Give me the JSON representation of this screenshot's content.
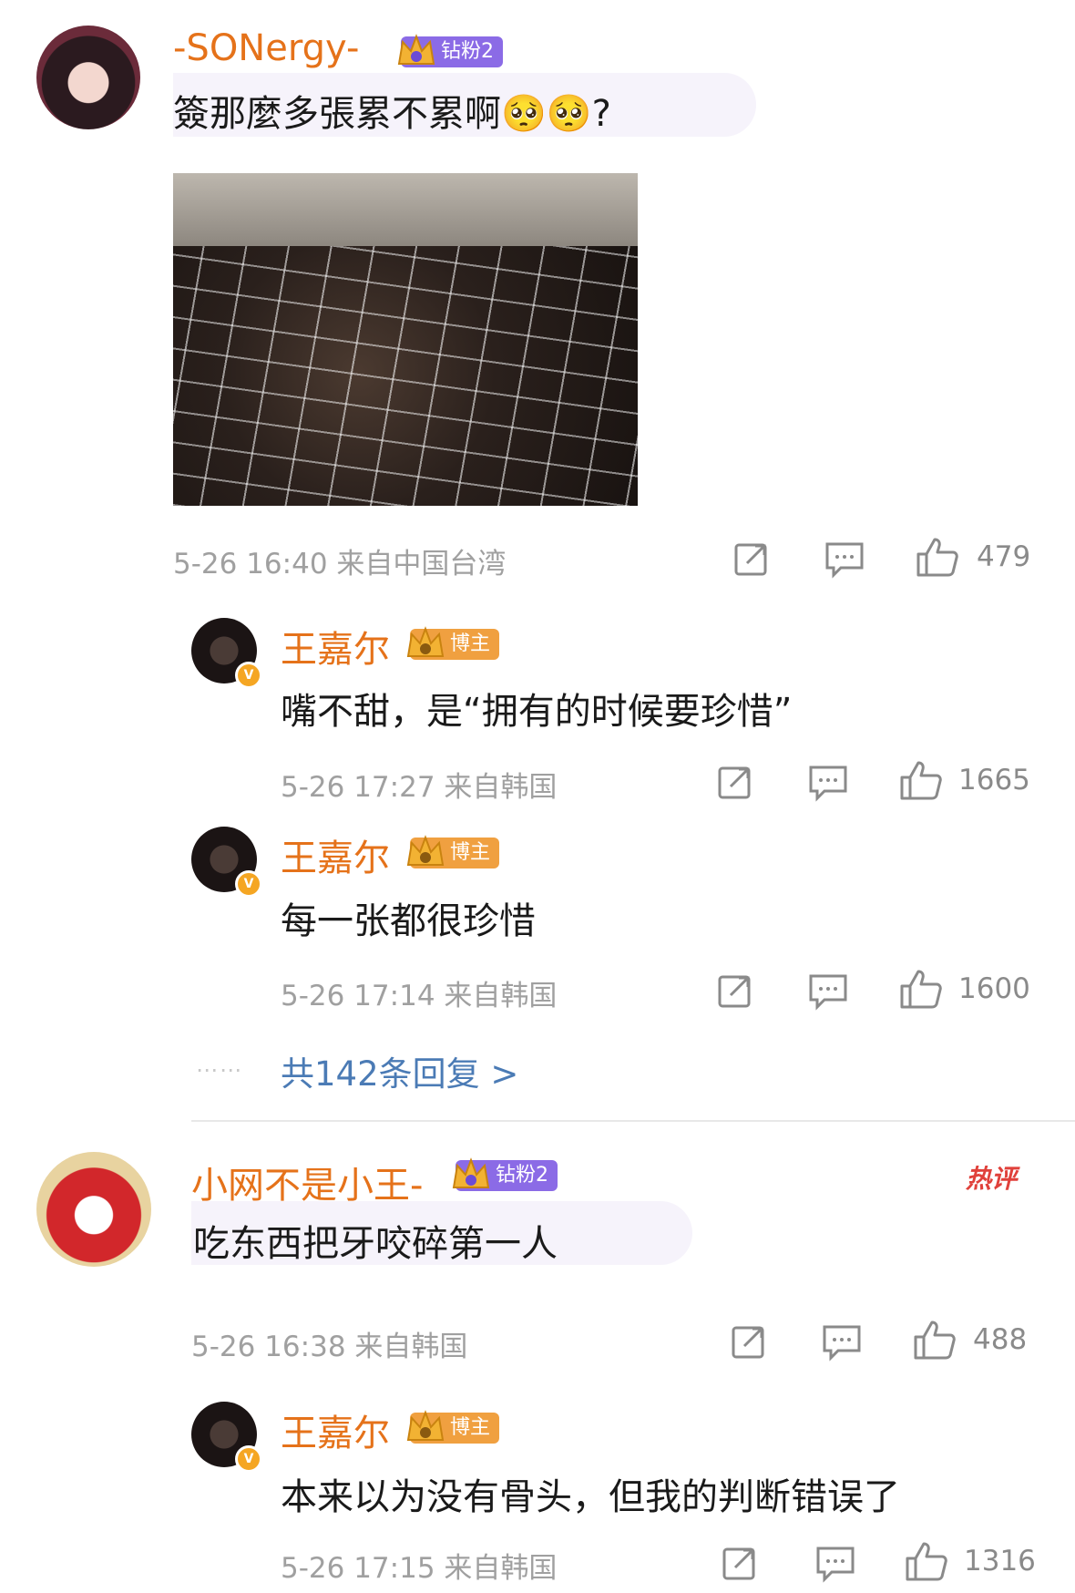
{
  "comments": [
    {
      "username": "-SONergy-",
      "badge": "钻粉2",
      "text": "簽那麼多張累不累啊🥺🥺?",
      "time": "5-26 16:40",
      "location": "来自中国台湾",
      "likes": "479",
      "replies": [
        {
          "username": "王嘉尔",
          "badge": "博主",
          "text": "嘴不甜，是“拥有的时候要珍惜”",
          "time": "5-26 17:27",
          "location": "来自韩国",
          "likes": "1665"
        },
        {
          "username": "王嘉尔",
          "badge": "博主",
          "text": "每一张都很珍惜",
          "time": "5-26 17:14",
          "location": "来自韩国",
          "likes": "1600"
        }
      ],
      "more_replies": "共142条回复 >"
    },
    {
      "username": "小网不是小王-",
      "badge": "钻粉2",
      "hot_label": "热评",
      "text": "吃东西把牙咬碎第一人",
      "time": "5-26 16:38",
      "location": "来自韩国",
      "likes": "488",
      "replies": [
        {
          "username": "王嘉尔",
          "badge": "博主",
          "text": "本来以为没有骨头，但我的判断错误了",
          "time": "5-26 17:15",
          "location": "来自韩国",
          "likes": "1316"
        }
      ]
    }
  ],
  "colors": {
    "username": "#e5721a",
    "link": "#4b7bb5",
    "meta": "#a0a0a0",
    "hot": "#e0413b"
  },
  "icons": [
    "share-icon",
    "comment-icon",
    "like-icon",
    "crown-icon",
    "verified-icon"
  ]
}
